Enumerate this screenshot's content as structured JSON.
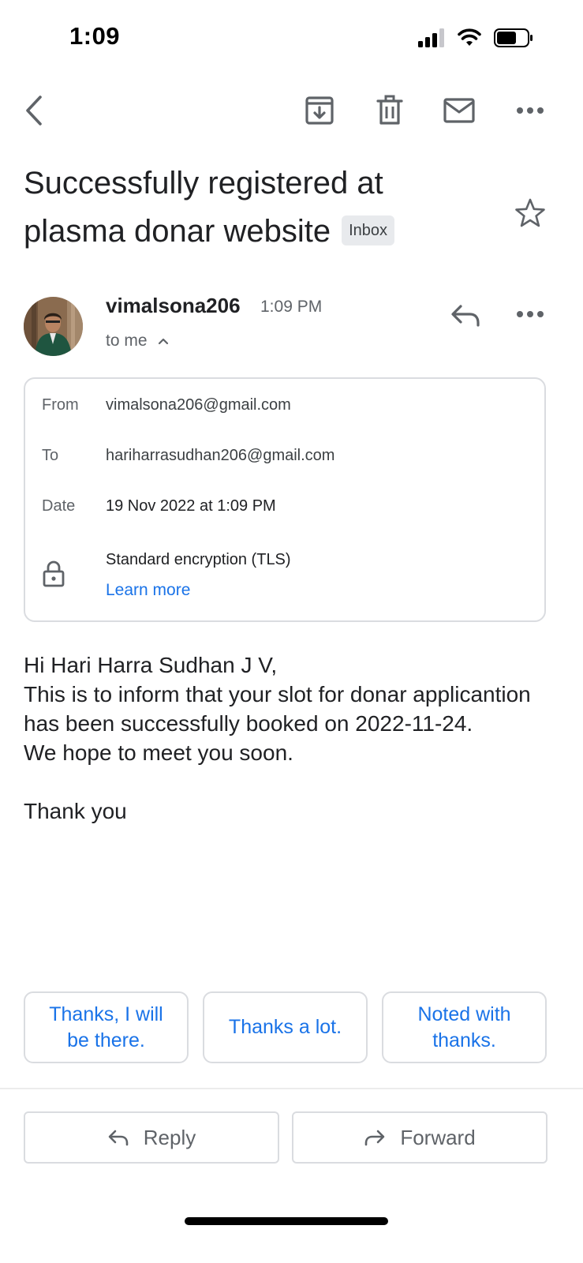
{
  "status_bar": {
    "time": "1:09"
  },
  "email": {
    "subject": "Successfully registered at plasma donar website",
    "label": "Inbox",
    "sender_name": "vimalsona206",
    "sent_time": "1:09 PM",
    "recipient_summary": "to me",
    "details": {
      "from_label": "From",
      "from_value": "vimalsona206@gmail.com",
      "to_label": "To",
      "to_value": "hariharrasudhan206@gmail.com",
      "date_label": "Date",
      "date_value": "19 Nov 2022 at 1:09 PM",
      "encryption_text": "Standard encryption (TLS)",
      "learn_more": "Learn more"
    },
    "body_lines": [
      "Hi Hari Harra Sudhan J V,",
      "This is to inform that your slot for donar applicantion has been successfully booked on 2022-11-24.",
      "We hope to meet you soon.",
      "",
      "Thank you"
    ]
  },
  "smart_replies": [
    "Thanks, I will be there.",
    "Thanks a lot.",
    "Noted with thanks."
  ],
  "actions": {
    "reply": "Reply",
    "forward": "Forward"
  },
  "colors": {
    "accent": "#1a73e8",
    "text": "#202124",
    "muted": "#5f6368",
    "border": "#dadce0"
  },
  "icons": [
    "back-icon",
    "archive-icon",
    "trash-icon",
    "mail-icon",
    "more-icon",
    "star-icon",
    "reply-icon",
    "lock-icon",
    "chevron-up-icon",
    "forward-icon"
  ]
}
